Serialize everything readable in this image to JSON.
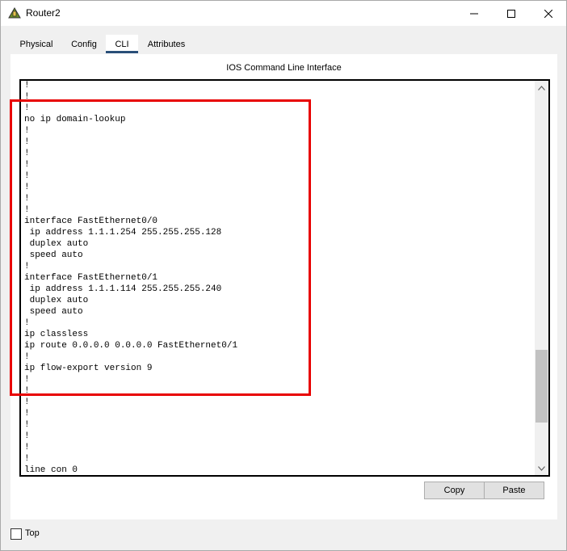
{
  "window": {
    "title": "Router2"
  },
  "tabs": [
    {
      "label": "Physical",
      "active": false
    },
    {
      "label": "Config",
      "active": false
    },
    {
      "label": "CLI",
      "active": true
    },
    {
      "label": "Attributes",
      "active": false
    }
  ],
  "cli": {
    "title": "IOS Command Line Interface",
    "text": "!\n!\n!\nno ip domain-lookup\n!\n!\n!\n!\n!\n!\n!\n!\ninterface FastEthernet0/0\n ip address 1.1.1.254 255.255.255.128\n duplex auto\n speed auto\n!\ninterface FastEthernet0/1\n ip address 1.1.1.114 255.255.255.240\n duplex auto\n speed auto\n!\nip classless\nip route 0.0.0.0 0.0.0.0 FastEthernet0/1\n!\nip flow-export version 9\n!\n!\n!\n!\n!\n!\n!\n!\nline con 0",
    "highlight_color": "#e80000"
  },
  "buttons": {
    "copy": "Copy",
    "paste": "Paste"
  },
  "top_checkbox": {
    "label": "Top",
    "checked": false
  },
  "icons": {
    "app": "router-app-icon",
    "minimize": "minimize-icon",
    "maximize": "maximize-icon",
    "close": "close-icon",
    "scroll_up": "scroll-up-arrow-icon",
    "scroll_down": "scroll-down-arrow-icon"
  }
}
